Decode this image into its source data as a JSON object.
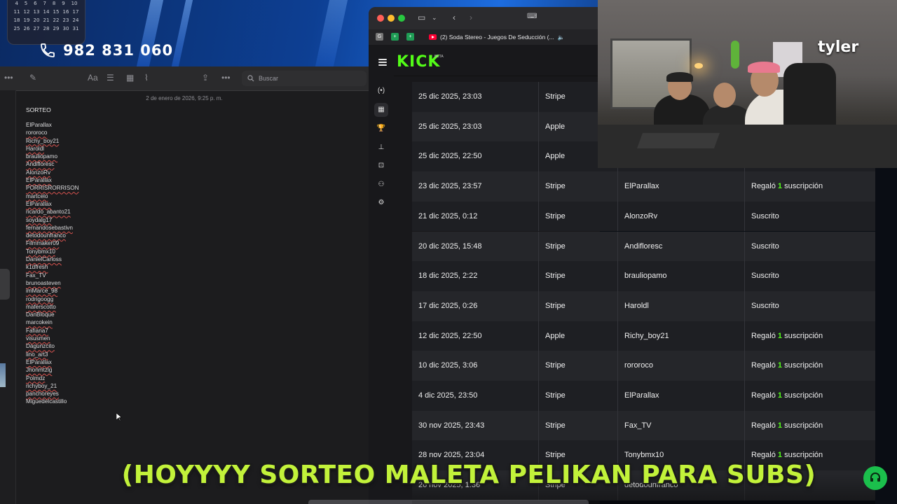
{
  "calendar": {
    "rows": [
      [
        "4",
        "5",
        "6",
        "7",
        "8",
        "9",
        "10"
      ],
      [
        "11",
        "12",
        "13",
        "14",
        "15",
        "16",
        "17"
      ],
      [
        "18",
        "19",
        "20",
        "21",
        "22",
        "23",
        "24"
      ],
      [
        "25",
        "26",
        "27",
        "28",
        "29",
        "30",
        "31"
      ]
    ]
  },
  "phone": {
    "number": "982 831 060"
  },
  "notes": {
    "search_placeholder": "Buscar",
    "date": "2 de enero de 2026, 9:25 p. m.",
    "title": "SORTEO",
    "names": [
      "ElParallax",
      "rororoco",
      "Richy_boy21",
      "Haroldl",
      "brauliopamo",
      "Andifloresc",
      "AlonzoRv",
      "ElParallax",
      "PORRISRORRISON",
      "martcelo",
      "ElParallax",
      "ricardo_abanto21",
      "soydalg17",
      "fernandosebastivn",
      "detodounfranco",
      "Filmmaker09",
      "Tonybmx10",
      "DanielCarloss",
      "k1dfresh",
      "Fax_TV",
      "brunoasteven",
      "imMarce_98",
      "rodrigoogg",
      "maferscotto",
      "DanBloque",
      "marcokein",
      "Fafiana7",
      "visusmen",
      "Dagunzcito",
      "lino_art3",
      "ElParallax",
      "Jhonmtzlg",
      "Polmdz",
      "richyboy_21",
      "panchoreyes",
      "Miguedelcastillo"
    ]
  },
  "browser": {
    "tab_title": "(2) Soda Stereo - Juegos De Seducción (...",
    "logo": "KICK",
    "logo_badge": "BETA"
  },
  "table": {
    "rows": [
      {
        "date": "25 dic 2025, 23:03",
        "method": "Stripe",
        "user": "",
        "action": "",
        "count": ""
      },
      {
        "date": "25 dic 2025, 23:03",
        "method": "Apple",
        "user": "",
        "action": "",
        "count": ""
      },
      {
        "date": "25 dic 2025, 22:50",
        "method": "Apple",
        "user": "",
        "action": "",
        "count": ""
      },
      {
        "date": "23 dic 2025, 23:57",
        "method": "Stripe",
        "user": "ElParallax",
        "action": "Regaló",
        "count": "1",
        "suffix": "suscripción"
      },
      {
        "date": "21 dic 2025, 0:12",
        "method": "Stripe",
        "user": "AlonzoRv",
        "action": "Suscrito",
        "count": "",
        "suffix": ""
      },
      {
        "date": "20 dic 2025, 15:48",
        "method": "Stripe",
        "user": "Andifloresc",
        "action": "Suscrito",
        "count": "",
        "suffix": ""
      },
      {
        "date": "18 dic 2025, 2:22",
        "method": "Stripe",
        "user": "brauliopamo",
        "action": "Suscrito",
        "count": "",
        "suffix": ""
      },
      {
        "date": "17 dic 2025, 0:26",
        "method": "Stripe",
        "user": "Haroldl",
        "action": "Suscrito",
        "count": "",
        "suffix": ""
      },
      {
        "date": "12 dic 2025, 22:50",
        "method": "Apple",
        "user": "Richy_boy21",
        "action": "Regaló",
        "count": "1",
        "suffix": "suscripción"
      },
      {
        "date": "10 dic 2025, 3:06",
        "method": "Stripe",
        "user": "rororoco",
        "action": "Regaló",
        "count": "1",
        "suffix": "suscripción"
      },
      {
        "date": "4 dic 2025, 23:50",
        "method": "Stripe",
        "user": "ElParallax",
        "action": "Regaló",
        "count": "1",
        "suffix": "suscripción"
      },
      {
        "date": "30 nov 2025, 23:43",
        "method": "Stripe",
        "user": "Fax_TV",
        "action": "Regaló",
        "count": "1",
        "suffix": "suscripción"
      },
      {
        "date": "28 nov 2025, 23:04",
        "method": "Stripe",
        "user": "Tonybmx10",
        "action": "Regaló",
        "count": "1",
        "suffix": "suscripción"
      },
      {
        "date": "26 nov 2025, 1:36",
        "method": "Stripe",
        "user": "detodounfranco",
        "action": "",
        "count": "",
        "suffix": ""
      }
    ]
  },
  "overlay": {
    "cam_logo": "tyler",
    "caption": "(HOYYYY SORTEO MALETA PELIKAN PARA SUBS)"
  },
  "colors": {
    "kick_green": "#53fc18",
    "caption": "#c2f23a"
  }
}
